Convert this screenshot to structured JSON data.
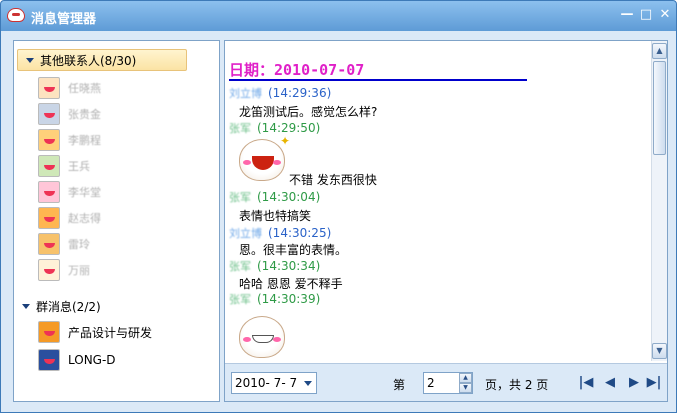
{
  "window": {
    "title": "消息管理器",
    "minimize": "—",
    "maximize": "□",
    "close": "✕"
  },
  "left": {
    "groups": [
      {
        "label": "其他联系人(8/30)",
        "contacts": [
          {
            "name": "任晓燕",
            "icon": "avatar-icon"
          },
          {
            "name": "张贵金",
            "icon": "avatar-icon"
          },
          {
            "name": "李鹏程",
            "icon": "avatar-icon"
          },
          {
            "name": "王兵",
            "icon": "avatar-icon"
          },
          {
            "name": "李华堂",
            "icon": "avatar-icon"
          },
          {
            "name": "赵志得",
            "icon": "avatar-icon"
          },
          {
            "name": "雷玲",
            "icon": "avatar-icon"
          },
          {
            "name": "万丽",
            "icon": "avatar-icon"
          }
        ]
      },
      {
        "label": "群消息(2/2)",
        "contacts": [
          {
            "name": "产品设计与研发"
          },
          {
            "name": "LONG-D"
          }
        ]
      }
    ]
  },
  "chat": {
    "date_title": "日期：2010-07-07",
    "messages": [
      {
        "sender": "刘立博",
        "time": "(14:29:36)",
        "text": "龙笛测试后。感觉怎么样?",
        "self": true
      },
      {
        "sender": "张军",
        "time": "(14:29:50)",
        "text": "不错 发东西很快",
        "emoji": true,
        "self": false
      },
      {
        "sender": "张军",
        "time": "(14:30:04)",
        "text": "表情也特搞笑",
        "self": false
      },
      {
        "sender": "刘立博",
        "time": "(14:30:25)",
        "text": "恩。很丰富的表情。",
        "self": true
      },
      {
        "sender": "张军",
        "time": "(14:30:34)",
        "text": "哈哈 恩恩 爱不释手",
        "self": false
      },
      {
        "sender": "张军",
        "time": "(14:30:39)",
        "text": "",
        "emoji": true,
        "self": false
      }
    ]
  },
  "footer": {
    "date_value": "2010- 7- 7",
    "page_prefix": "第",
    "page_value": "2",
    "page_suffix": "页，共 2 页",
    "nav": {
      "first": "|◀",
      "prev": "◀",
      "next": "▶",
      "last": "▶|"
    }
  },
  "colors": {
    "date_title": "#e020c8",
    "self_time": "#2a62c8",
    "other_time": "#2e9a46",
    "selected_group": "#fbe3a4"
  }
}
